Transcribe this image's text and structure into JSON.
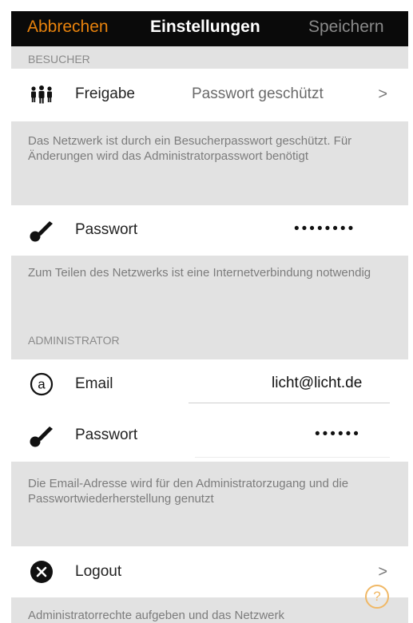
{
  "navbar": {
    "cancel_label": "Abbrechen",
    "title": "Einstellungen",
    "save_label": "Speichern"
  },
  "visitor": {
    "header": "BESUCHER",
    "share_label": "Freigabe",
    "share_value": "Passwort geschützt",
    "share_chevron": ">",
    "share_note": "Das Netzwerk ist durch ein Besucherpasswort geschützt. Für Änderungen wird das Administratorpasswort benötigt",
    "password_label": "Passwort",
    "password_value": "••••••••",
    "password_note": "Zum Teilen des Netzwerks ist eine Internetverbindung notwendig"
  },
  "administrator": {
    "header": "ADMINISTRATOR",
    "email_label": "Email",
    "email_value": "licht@licht.de",
    "password_label": "Passwort",
    "password_value": "••••••",
    "note": "Die Email-Adresse wird für den Administratorzugang und die Passwortwiederherstellung genutzt"
  },
  "logout": {
    "label": "Logout",
    "chevron": ">",
    "note": "Administratorrechte aufgeben und das Netzwerk"
  },
  "help_glyph": "?",
  "colors": {
    "accent": "#e8820c",
    "navbar_bg": "#0a0a0a",
    "group_bg": "#e2e2e2"
  }
}
